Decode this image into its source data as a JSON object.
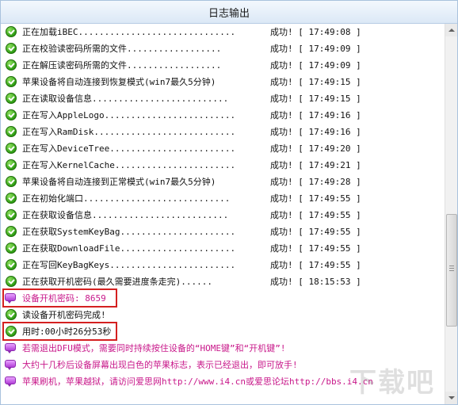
{
  "window": {
    "title": "日志输出"
  },
  "log": [
    {
      "text": "正在加载iBEC..............................",
      "time": "成功! [ 17:49:08 ]"
    },
    {
      "text": "正在校验读密码所需的文件..................",
      "time": "成功! [ 17:49:09 ]"
    },
    {
      "text": "正在解压读密码所需的文件..................",
      "time": "成功! [ 17:49:09 ]"
    },
    {
      "text": "苹果设备将自动连接到恢复模式(win7最久5分钟)",
      "time": "成功! [ 17:49:15 ]"
    },
    {
      "text": "正在读取设备信息..........................",
      "time": "成功! [ 17:49:15 ]"
    },
    {
      "text": "正在写入AppleLogo.........................",
      "time": "成功! [ 17:49:16 ]"
    },
    {
      "text": "正在写入RamDisk...........................",
      "time": "成功! [ 17:49:16 ]"
    },
    {
      "text": "正在写入DeviceTree........................",
      "time": "成功! [ 17:49:20 ]"
    },
    {
      "text": "正在写入KernelCache.......................",
      "time": "成功! [ 17:49:21 ]"
    },
    {
      "text": "苹果设备将自动连接到正常模式(win7最久5分钟)",
      "time": "成功! [ 17:49:28 ]"
    },
    {
      "text": "正在初始化端口............................",
      "time": "成功! [ 17:49:55 ]"
    },
    {
      "text": "正在获取设备信息..........................",
      "time": "成功! [ 17:49:55 ]"
    },
    {
      "text": "正在获取SystemKeyBag......................",
      "time": "成功! [ 17:49:55 ]"
    },
    {
      "text": "正在获取DownloadFile......................",
      "time": "成功! [ 17:49:55 ]"
    },
    {
      "text": "正在写回KeyBagKeys........................",
      "time": "成功! [ 17:49:55 ]"
    },
    {
      "text": "正在获取开机密码(最久需要进度条走完)......",
      "time": "成功! [ 18:15:53 ]"
    },
    {
      "text": "设备开机密码: 8659",
      "time": ""
    },
    {
      "text": "读设备开机密码完成!",
      "time": ""
    },
    {
      "text": "用时:00小时26分53秒",
      "time": ""
    },
    {
      "text": "若需退出DFU模式，需要同时持续按住设备的“HOME键”和“开机键”!",
      "time": ""
    },
    {
      "text": "大约十几秒后设备屏幕出现白色的苹果标志，表示已经退出，即可放手!",
      "time": ""
    },
    {
      "text": "苹果刷机，苹果越狱，请访问爱思网http://www.i4.cn或爱思论坛http://bbs.i4.cn",
      "time": ""
    }
  ],
  "icons": {
    "success": "check-circle-icon",
    "info": "speech-bubble-icon"
  },
  "colors": {
    "info_text": "#c8188a",
    "highlight_border": "#d42020"
  },
  "watermark": {
    "text": "下载吧"
  }
}
